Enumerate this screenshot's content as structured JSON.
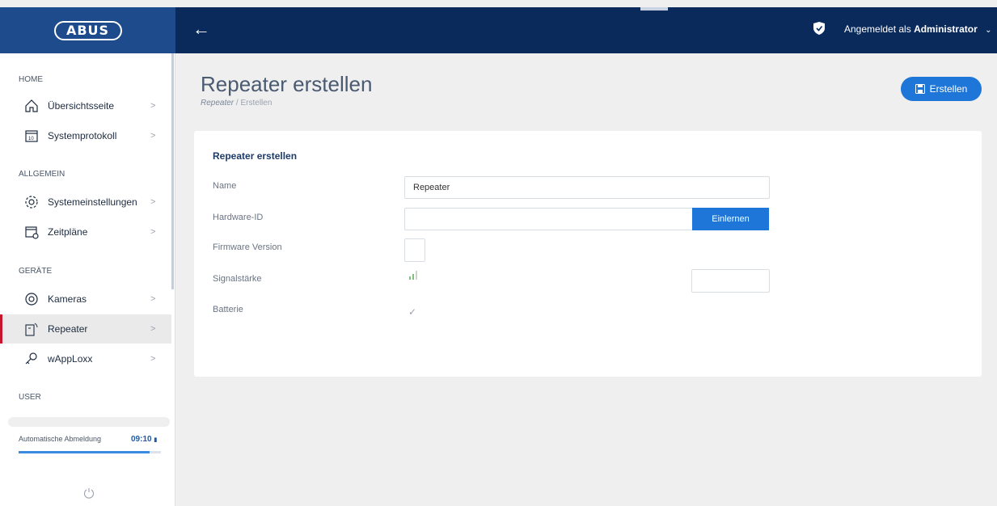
{
  "header": {
    "logo_text": "ABUS",
    "user_prefix": "Angemeldet als",
    "user_name": "Administrator"
  },
  "sidebar": {
    "sections": [
      {
        "label": "HOME"
      },
      {
        "label": "ALLGEMEIN"
      },
      {
        "label": "GERÄTE"
      },
      {
        "label": "USER"
      }
    ],
    "items": [
      {
        "label": "Übersichtsseite",
        "icon": "home-icon"
      },
      {
        "label": "Systemprotokoll",
        "icon": "calendar-icon"
      },
      {
        "label": "Systemeinstellungen",
        "icon": "gear-icon"
      },
      {
        "label": "Zeitpläne",
        "icon": "schedule-icon"
      },
      {
        "label": "Kameras",
        "icon": "camera-icon"
      },
      {
        "label": "Repeater",
        "icon": "repeater-icon",
        "active": true
      },
      {
        "label": "wAppLoxx",
        "icon": "key-icon"
      }
    ],
    "auto_logout_label": "Automatische Abmeldung",
    "timer": "09:10",
    "timer_progress": 0.92
  },
  "page": {
    "title": "Repeater erstellen",
    "breadcrumb_link": "Repeater",
    "breadcrumb_sep": "/",
    "breadcrumb_current": "Erstellen",
    "create_button": "Erstellen"
  },
  "form": {
    "title": "Repeater erstellen",
    "name_label": "Name",
    "name_value": "Repeater",
    "hardware_id_label": "Hardware-ID",
    "hardware_id_value": "",
    "learn_button": "Einlernen",
    "firmware_label": "Firmware Version",
    "signal_label": "Signalstärke",
    "battery_label": "Batterie"
  },
  "colors": {
    "topbar": "#0a2a5c",
    "accent": "#1d76d8",
    "active_marker": "#c7162b"
  }
}
